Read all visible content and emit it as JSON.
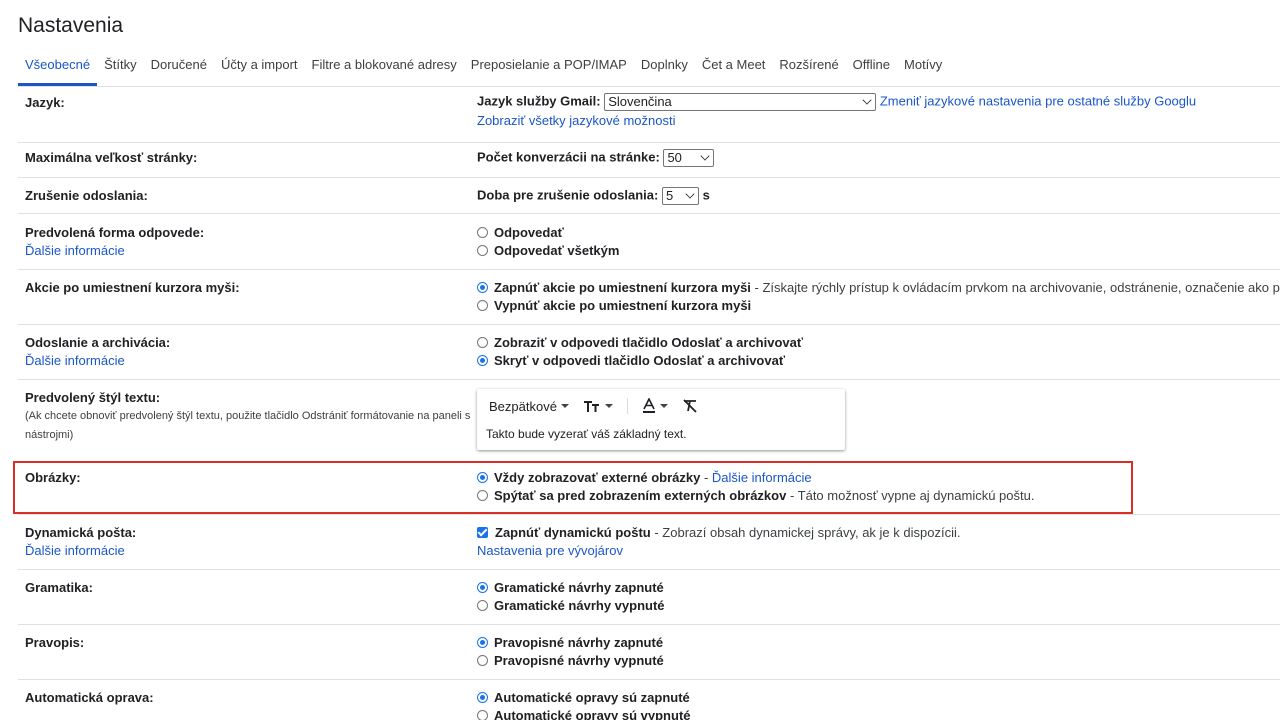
{
  "page": {
    "title": "Nastavenia"
  },
  "tabs": [
    {
      "label": "Všeobecné",
      "active": true
    },
    {
      "label": "Štítky"
    },
    {
      "label": "Doručené"
    },
    {
      "label": "Účty a import"
    },
    {
      "label": "Filtre a blokované adresy"
    },
    {
      "label": "Preposielanie a POP/IMAP"
    },
    {
      "label": "Doplnky"
    },
    {
      "label": "Čet a Meet"
    },
    {
      "label": "Rozšírené"
    },
    {
      "label": "Offline"
    },
    {
      "label": "Motívy"
    }
  ],
  "settings": {
    "language": {
      "label": "Jazyk:",
      "field_label": "Jazyk služby Gmail:",
      "selected": "Slovenčina",
      "change_link": "Zmeniť jazykové nastavenia pre ostatné služby Googlu",
      "all_options_link": "Zobraziť všetky jazykové možnosti"
    },
    "page_size": {
      "label": "Maximálna veľkosť stránky:",
      "field_label": "Počet konverzácii na stránke:",
      "selected": "50"
    },
    "undo_send": {
      "label": "Zrušenie odoslania:",
      "field_label": "Doba pre zrušenie odoslania:",
      "selected": "5",
      "unit": "s"
    },
    "reply_behavior": {
      "label": "Predvolená forma odpovede:",
      "learn_more": "Ďalšie informácie",
      "options": [
        {
          "text": "Odpovedať",
          "checked": false
        },
        {
          "text": "Odpovedať všetkým",
          "checked": false
        }
      ]
    },
    "hover_actions": {
      "label": "Akcie po umiestnení kurzora myši:",
      "options": [
        {
          "text": "Zapnúť akcie po umiestnení kurzora myši",
          "desc": " - Získajte rýchly prístup k ovládacím prvkom na archivovanie, odstránenie, označenie ako preč",
          "checked": true
        },
        {
          "text": "Vypnúť akcie po umiestnení kurzora myši",
          "checked": false
        }
      ]
    },
    "send_archive": {
      "label": "Odoslanie a archivácia:",
      "learn_more": "Ďalšie informácie",
      "options": [
        {
          "text": "Zobraziť v odpovedi tlačidlo Odoslať a archivovať",
          "checked": false
        },
        {
          "text": "Skryť v odpovedi tlačidlo Odoslať a archivovať",
          "checked": true
        }
      ]
    },
    "text_style": {
      "label": "Predvolený štýl textu:",
      "note": "(Ak chcete obnoviť predvolený štýl textu, použite tlačidlo Odstrániť formátovanie na paneli s nástrojmi)",
      "font": "Bezpätkové",
      "preview": "Takto bude vyzerať váš základný text."
    },
    "images": {
      "label": "Obrázky:",
      "options": [
        {
          "text": "Vždy zobrazovať externé obrázky",
          "sep": " - ",
          "link": "Ďalšie informácie",
          "checked": true
        },
        {
          "text": "Spýtať sa pred zobrazením externých obrázkov",
          "desc": " - Táto možnosť vypne aj dynamickú poštu.",
          "checked": false
        }
      ],
      "highlight_color": "#d93025"
    },
    "dynamic_mail": {
      "label": "Dynamická pošta:",
      "learn_more": "Ďalšie informácie",
      "checkbox": {
        "text": "Zapnúť dynamickú poštu",
        "desc": " - Zobrazí obsah dynamickej správy, ak je k dispozícii.",
        "checked": true
      },
      "dev_link": "Nastavenia pre vývojárov"
    },
    "grammar": {
      "label": "Gramatika:",
      "options": [
        {
          "text": "Gramatické návrhy zapnuté",
          "checked": true
        },
        {
          "text": "Gramatické návrhy vypnuté",
          "checked": false
        }
      ]
    },
    "spelling": {
      "label": "Pravopis:",
      "options": [
        {
          "text": "Pravopisné návrhy zapnuté",
          "checked": true
        },
        {
          "text": "Pravopisné návrhy vypnuté",
          "checked": false
        }
      ]
    },
    "autocorrect": {
      "label": "Automatická oprava:",
      "options": [
        {
          "text": "Automatické opravy sú zapnuté",
          "checked": true
        },
        {
          "text": "Automatické opravy sú vypnuté",
          "checked": false
        }
      ]
    }
  },
  "colors": {
    "accent": "#1a73e8",
    "link": "#1a56c8",
    "divider": "#e0e0e0"
  }
}
